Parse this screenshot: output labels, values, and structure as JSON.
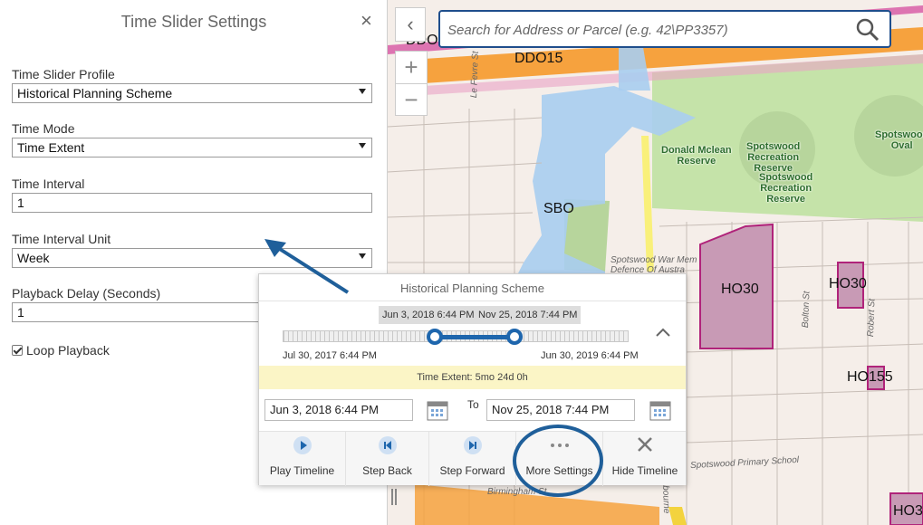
{
  "panel": {
    "title": "Time Slider Settings",
    "close_glyph": "×",
    "fields": {
      "profile_label": "Time Slider Profile",
      "profile_value": "Historical Planning Scheme",
      "mode_label": "Time Mode",
      "mode_value": "Time Extent",
      "interval_label": "Time Interval",
      "interval_value": "1",
      "unit_label": "Time Interval Unit",
      "unit_value": "Week",
      "delay_label": "Playback Delay (Seconds)",
      "delay_value": "1",
      "loop_label": "Loop Playback",
      "loop_checked": true
    }
  },
  "map": {
    "collapse_glyph": "‹",
    "zoom_in": "+",
    "zoom_out": "−",
    "search_placeholder": "Search for Address or Parcel (e.g. 42\\PP3357)",
    "labels": {
      "ddo15": "DDO15",
      "ddo_partial": "DDO",
      "sbo": "SBO",
      "ho30_a": "HO30",
      "ho30_b": "HO30",
      "ho155": "HO155",
      "ho3_partial": "HO3",
      "donald": "Donald Mclean\nReserve",
      "spotswood_rec1": "Spotswood\nRecreation\nReserve",
      "spotswood_rec2": "Spotswood\nRecreation\nReserve",
      "spotswood_oval": "Spotswood\nOval",
      "le_fevre": "Le Fevre St",
      "bolton": "Bolton St",
      "robert": "Robert St",
      "school": "Spotswood Primary School",
      "birmingham": "Birmingham St",
      "war_memorial": "Spotswood War Mem\nDefence Of Austra",
      "bourne": "bourne"
    }
  },
  "time_slider": {
    "title": "Historical Planning Scheme",
    "range_start": "Jun 3, 2018 6:44 PM",
    "range_end": "Nov 25, 2018 7:44 PM",
    "track_min": "Jul 30, 2017 6:44 PM",
    "track_max": "Jun 30, 2019 6:44 PM",
    "extent_text": "Time Extent: 5mo 24d 0h",
    "from_value": "Jun 3, 2018 6:44 PM",
    "to_label": "To",
    "to_value": "Nov 25, 2018 7:44 PM",
    "selection_start_fraction": 0.44,
    "selection_end_fraction": 0.67,
    "buttons": [
      {
        "label": "Play Timeline",
        "icon": "play-icon"
      },
      {
        "label": "Step Back",
        "icon": "step-back-icon"
      },
      {
        "label": "Step Forward",
        "icon": "step-forward-icon"
      },
      {
        "label": "More Settings",
        "icon": "more-icon"
      },
      {
        "label": "Hide Timeline",
        "icon": "close-icon"
      }
    ]
  },
  "colors": {
    "accent": "#1e66ad",
    "water": "#a9cdf0",
    "park": "#c5e3a9",
    "heritage": "#c89ab5",
    "overlay_orange": "#f6a23e"
  }
}
